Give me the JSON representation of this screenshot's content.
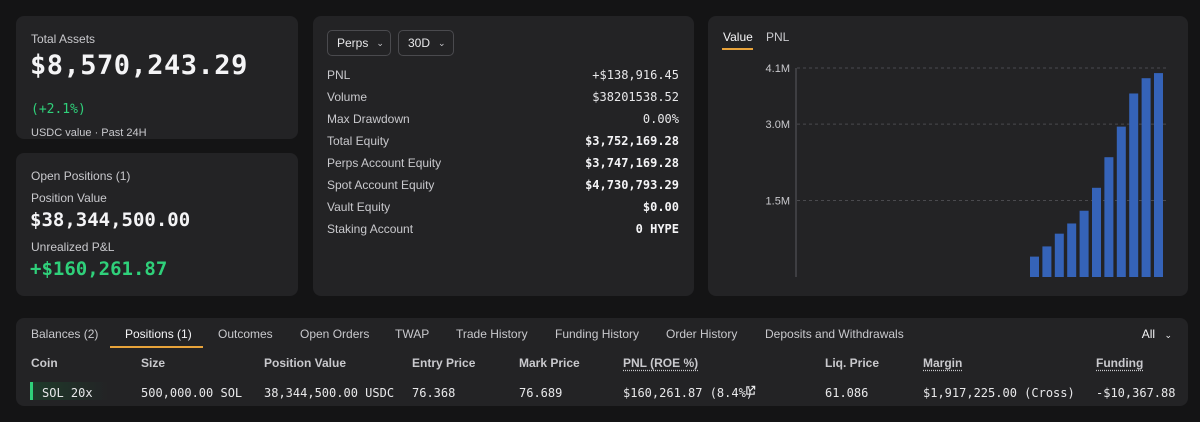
{
  "total_assets": {
    "label": "Total Assets",
    "value": "$8,570,243.29",
    "change": "(+2.1%)",
    "subtitle": "USDC value · Past 24H"
  },
  "open_positions": {
    "title": "Open Positions (1)",
    "position_value_label": "Position Value",
    "position_value": "$38,344,500.00",
    "unrealized_label": "Unrealized P&L",
    "unrealized_value": "+$160,261.87"
  },
  "stats": {
    "market_select": "Perps",
    "range_select": "30D",
    "rows": [
      {
        "label": "PNL",
        "value": "+$138,916.45"
      },
      {
        "label": "Volume",
        "value": "$38201538.52"
      },
      {
        "label": "Max Drawdown",
        "value": "0.00%"
      },
      {
        "label": "Total Equity",
        "value": "$3,752,169.28"
      },
      {
        "label": "Perps Account Equity",
        "value": "$3,747,169.28"
      },
      {
        "label": "Spot Account Equity",
        "value": "$4,730,793.29"
      },
      {
        "label": "Vault Equity",
        "value": "$0.00"
      },
      {
        "label": "Staking Account",
        "value": "0 HYPE"
      }
    ]
  },
  "chart_tabs": {
    "value": "Value",
    "pnl": "PNL"
  },
  "chart_data": {
    "type": "bar",
    "yticks": [
      "4.1M",
      "3.0M",
      "1.5M"
    ],
    "ytick_values": [
      4.1,
      3.0,
      1.5
    ],
    "ylim": [
      0,
      4.1
    ],
    "values": [
      0.4,
      0.6,
      0.85,
      1.05,
      1.3,
      1.75,
      2.35,
      2.95,
      3.6,
      3.9,
      4.0
    ],
    "color": "#3563b8"
  },
  "table": {
    "tabs": [
      "Balances (2)",
      "Positions (1)",
      "Outcomes",
      "Open Orders",
      "TWAP",
      "Trade History",
      "Funding History",
      "Order History",
      "Deposits and Withdrawals"
    ],
    "filter": "All",
    "headers": [
      "Coin",
      "Size",
      "Position Value",
      "Entry Price",
      "Mark Price",
      "PNL (ROE %)",
      "Liq. Price",
      "Margin",
      "Funding"
    ],
    "row": {
      "coin": "SOL 20x",
      "size": "500,000.00 SOL",
      "position_value": "38,344,500.00 USDC",
      "entry_price": "76.368",
      "mark_price": "76.689",
      "pnl": "$160,261.87 (8.4%)",
      "liq_price": "61.086",
      "margin": "$1,917,225.00 (Cross)",
      "funding": "-$10,367.88"
    }
  },
  "colors": {
    "accent": "#e8a33a",
    "positive": "#2fd07a",
    "negative": "#f2525a",
    "bar": "#3563b8"
  }
}
